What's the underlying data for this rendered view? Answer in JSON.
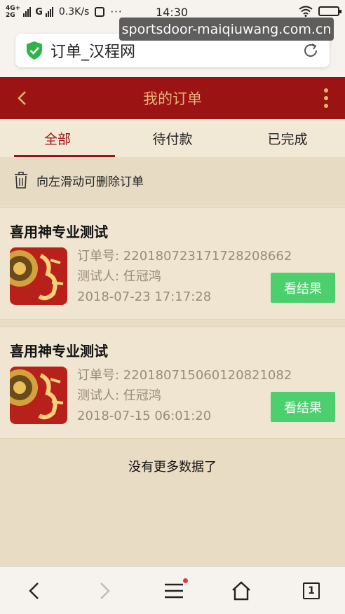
{
  "status_bar": {
    "network1": "4G+",
    "network2": "2G",
    "network3": "G",
    "speed": "0.3K/s",
    "dots": "···",
    "time": "14:30"
  },
  "watermark": "sportsdoor-maiqiuwang.com.cn",
  "browser": {
    "page_title": "订单_汉程网"
  },
  "header": {
    "title": "我的订单"
  },
  "tabs": [
    {
      "label": "全部",
      "active": true
    },
    {
      "label": "待付款",
      "active": false
    },
    {
      "label": "已完成",
      "active": false
    }
  ],
  "tip": "向左滑动可删除订单",
  "orders": [
    {
      "title": "喜用神专业测试",
      "order_no": "订单号: 220180723171728208662",
      "tester": "测试人: 任冠鸿",
      "datetime": "2018-07-23 17:17:28",
      "button": "看结果"
    },
    {
      "title": "喜用神专业测试",
      "order_no": "订单号: 220180715060120821082",
      "tester": "测试人: 任冠鸿",
      "datetime": "2018-07-15 06:01:20",
      "button": "看结果"
    }
  ],
  "no_more": "没有更多数据了",
  "bottom_nav": {
    "tab_count": "1"
  },
  "colors": {
    "header_bg": "#9b1313",
    "header_text": "#e6b47a",
    "button_green": "#4cd06e",
    "page_bg": "#e9dcc4"
  },
  "icons": [
    "shield-check-icon",
    "refresh-icon",
    "back-arrow-icon",
    "more-vertical-icon",
    "trash-icon",
    "chevron-left-icon",
    "chevron-right-icon",
    "menu-icon",
    "home-icon",
    "tabs-icon"
  ]
}
